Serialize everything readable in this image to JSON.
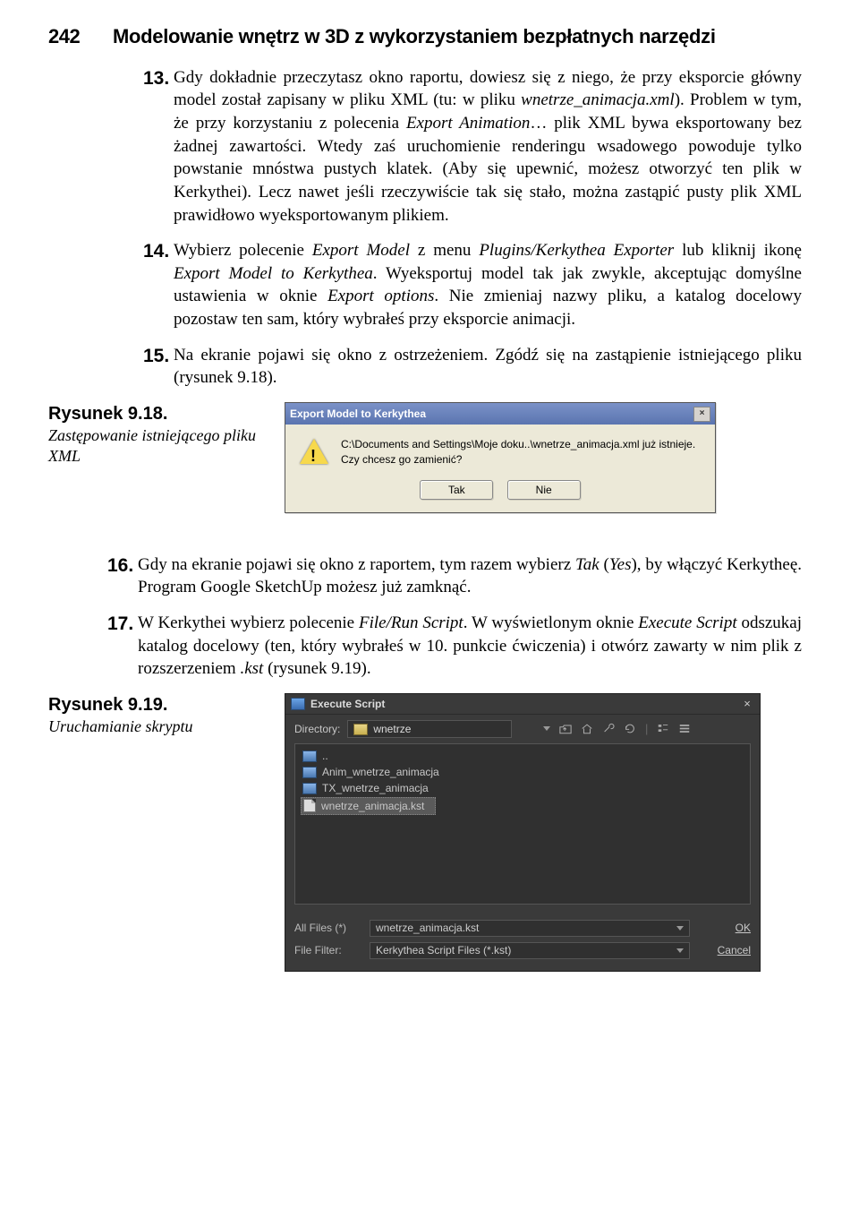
{
  "header": {
    "page_number": "242",
    "book_title": "Modelowanie wnętrz w 3D z wykorzystaniem bezpłatnych narzędzi"
  },
  "items": {
    "i13": {
      "num": "13.",
      "text_a": "Gdy dokładnie przeczytasz okno raportu, dowiesz się z niego, że przy eksporcie główny model został zapisany w pliku XML (tu: w pliku ",
      "fn1": "wnetrze_animacja.xml",
      "text_b": "). Problem w tym, że przy korzystaniu z polecenia ",
      "em1": "Export Animation",
      "text_c": "… plik XML bywa eksportowany bez żadnej zawartości. Wtedy zaś uruchomienie renderingu wsadowego powoduje tylko powstanie mnóstwa pustych klatek. (Aby się upewnić, możesz otworzyć ten plik w Kerkythei). Lecz nawet jeśli rzeczywiście tak się stało, można zastąpić pusty plik XML prawidłowo wyeksportowanym plikiem."
    },
    "i14": {
      "num": "14.",
      "text_a": "Wybierz polecenie ",
      "em1": "Export Model",
      "text_b": " z menu ",
      "em2": "Plugins/Kerkythea Exporter",
      "text_c": " lub kliknij ikonę ",
      "em3": "Export Model to Kerkythea",
      "text_d": ". Wyeksportuj model tak jak zwykle, akceptując domyślne ustawienia w oknie ",
      "em4": "Export options",
      "text_e": ". Nie zmieniaj nazwy pliku, a katalog docelowy pozostaw ten sam, który wybrałeś przy eksporcie animacji."
    },
    "i15": {
      "num": "15.",
      "text_a": "Na ekranie pojawi się okno z ostrzeżeniem. Zgódź się na zastąpienie istniejącego pliku (rysunek 9.18)."
    },
    "i16": {
      "num": "16.",
      "text_a": "Gdy na ekranie pojawi się okno z raportem, tym razem wybierz ",
      "em1": "Tak",
      "text_b": " (",
      "em2": "Yes",
      "text_c": "), by włączyć Kerkytheę. Program Google SketchUp możesz już zamknąć."
    },
    "i17": {
      "num": "17.",
      "text_a": "W Kerkythei wybierz polecenie ",
      "em1": "File/Run Script",
      "text_b": ". W wyświetlonym oknie ",
      "em2": "Execute Script",
      "text_c": " odszukaj katalog docelowy (ten, który wybrałeś w 10. punkcie ćwiczenia) i otwórz zawarty w nim plik z rozszerzeniem ",
      "em3": ".kst",
      "text_d": " (rysunek 9.19)."
    }
  },
  "fig918": {
    "title": "Rysunek 9.18.",
    "desc": "Zastępowanie istniejącego pliku XML"
  },
  "fig919": {
    "title": "Rysunek 9.19.",
    "desc": "Uruchamianie skryptu"
  },
  "dialog1": {
    "title": "Export Model to Kerkythea",
    "line1": "C:\\Documents and Settings\\Moje doku..\\wnetrze_animacja.xml już istnieje.",
    "line2": "Czy chcesz go zamienić?",
    "btn_yes": "Tak",
    "btn_no": "Nie"
  },
  "dialog2": {
    "title": "Execute Script",
    "dir_label": "Directory:",
    "dir_value": "wnetrze",
    "files": {
      "up": "..",
      "f1": "Anim_wnetrze_animacja",
      "f2": "TX_wnetrze_animacja",
      "f3": "wnetrze_animacja.kst"
    },
    "row1_label": "All Files (*)",
    "row1_value": "wnetrze_animacja.kst",
    "row1_action": "OK",
    "row2_label": "File Filter:",
    "row2_value": "Kerkythea Script Files (*.kst)",
    "row2_action": "Cancel"
  }
}
